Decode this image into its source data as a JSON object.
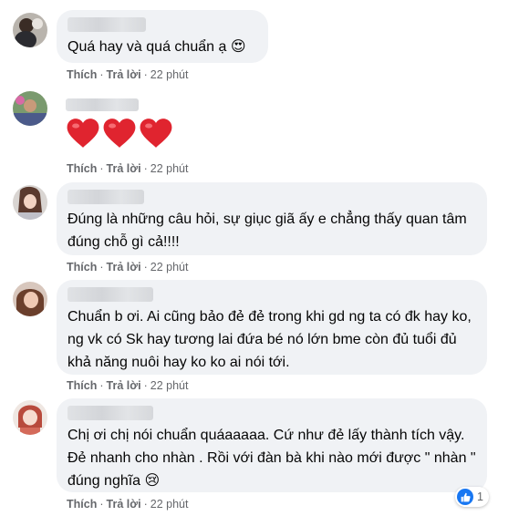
{
  "comments": [
    {
      "avatar": "avatar-user-1",
      "text": "Quá hay và quá chuẩn ạ",
      "emoji": "😍",
      "actions": {
        "like": "Thích",
        "reply": "Trả lời",
        "time": "22 phút"
      }
    },
    {
      "avatar": "avatar-user-2",
      "hearts": [
        "heart-icon",
        "heart-icon",
        "heart-icon"
      ],
      "actions": {
        "like": "Thích",
        "reply": "Trả lời",
        "time": "22 phút"
      }
    },
    {
      "avatar": "avatar-user-3",
      "text": "Đúng là những câu hỏi, sự giục giã ấy e chẳng thấy quan tâm đúng chỗ gì cả!!!!",
      "actions": {
        "like": "Thích",
        "reply": "Trả lời",
        "time": "22 phút"
      }
    },
    {
      "avatar": "avatar-user-4",
      "text": "Chuẩn b ơi. Ai cũng bảo đẻ đẻ trong khi gd ng ta có đk hay ko, ng vk có Sk hay tương lai đứa bé nó lớn bme còn đủ tuổi đủ khả năng nuôi hay ko ko ai nói tới.",
      "actions": {
        "like": "Thích",
        "reply": "Trả lời",
        "time": "22 phút"
      }
    },
    {
      "avatar": "avatar-user-5",
      "text": "Chị ơi chị nói chuẩn quáaaaaa. Cứ như đẻ lấy thành tích vậy. Đẻ nhanh cho nhàn . Rồi với đàn bà khi nào mới được \" nhàn \" đúng nghĩa",
      "emoji": "😢",
      "actions": {
        "like": "Thích",
        "reply": "Trả lời",
        "time": "22 phút"
      },
      "reaction": {
        "icon": "like-icon",
        "count": "1"
      }
    }
  ],
  "colors": {
    "bubble": "#f0f2f5",
    "action_text": "#65676b",
    "like_blue": "#1877f2",
    "heart_red": "#e0242f"
  }
}
